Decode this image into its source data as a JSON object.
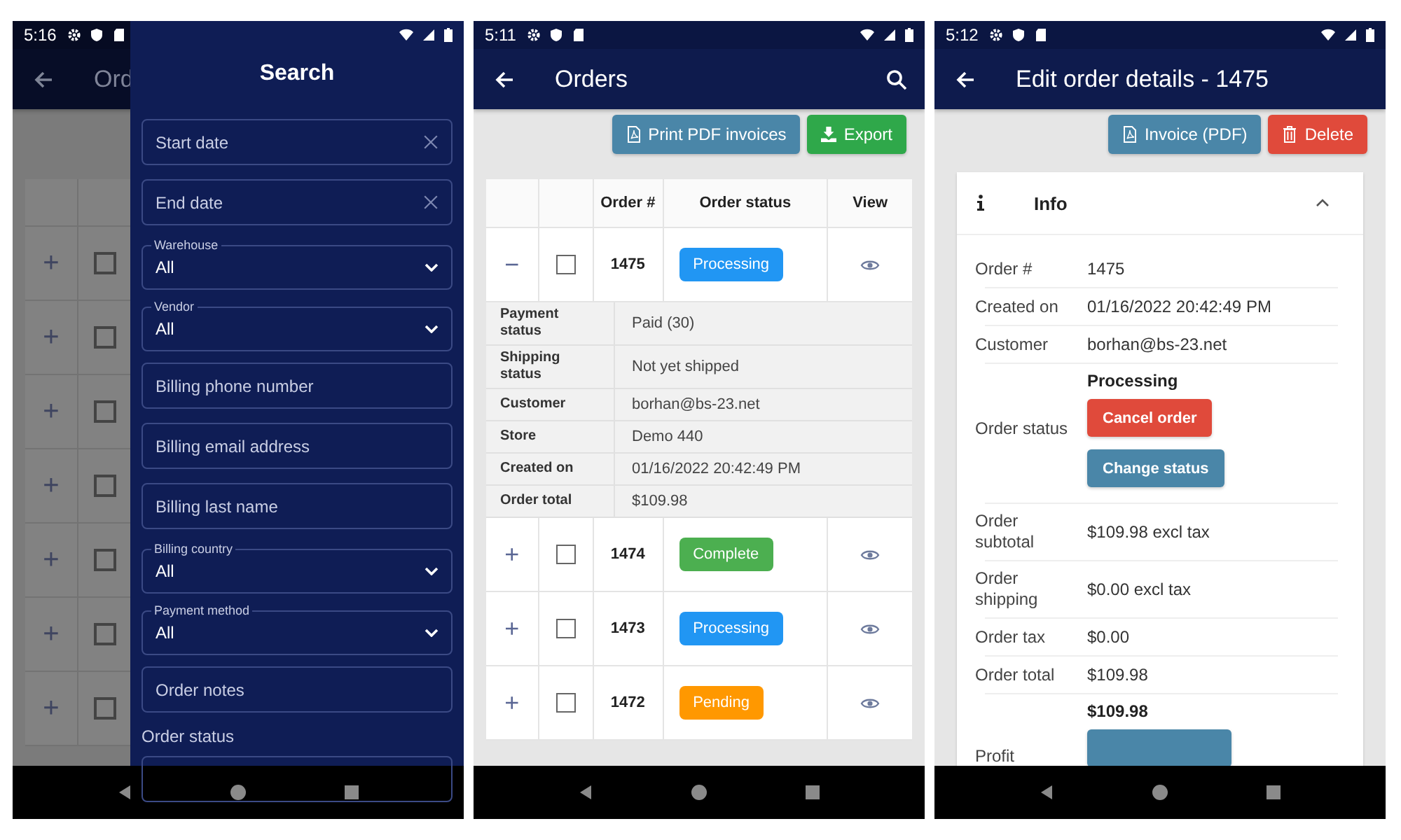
{
  "search_screen": {
    "status_bar": {
      "time": "5:16"
    },
    "background": {
      "title": "Ord",
      "rows": [
        {
          "expand": "+",
          "checked": false
        },
        {
          "expand": "+",
          "checked": false
        },
        {
          "expand": "+",
          "checked": false
        },
        {
          "expand": "+",
          "checked": false
        },
        {
          "expand": "+",
          "checked": false
        },
        {
          "expand": "+",
          "checked": false
        },
        {
          "expand": "+",
          "checked": false
        }
      ]
    },
    "drawer": {
      "title": "Search",
      "fields": [
        {
          "kind": "text",
          "placeholder": "Start date",
          "clearable": true
        },
        {
          "kind": "text",
          "placeholder": "End date",
          "clearable": true
        },
        {
          "kind": "select",
          "label": "Warehouse",
          "value": "All"
        },
        {
          "kind": "select",
          "label": "Vendor",
          "value": "All"
        },
        {
          "kind": "text",
          "placeholder": "Billing phone number",
          "clearable": false
        },
        {
          "kind": "text",
          "placeholder": "Billing email address",
          "clearable": false
        },
        {
          "kind": "text",
          "placeholder": "Billing last name",
          "clearable": false
        },
        {
          "kind": "select",
          "label": "Billing country",
          "value": "All"
        },
        {
          "kind": "select",
          "label": "Payment method",
          "value": "All"
        },
        {
          "kind": "text",
          "placeholder": "Order notes",
          "clearable": false
        }
      ],
      "section_label": "Order status"
    }
  },
  "orders_screen": {
    "status_bar": {
      "time": "5:11"
    },
    "title": "Orders",
    "actions": [
      {
        "kind": "pdf",
        "label": "Print PDF invoices"
      },
      {
        "kind": "export",
        "label": "Export"
      }
    ],
    "columns": {
      "number": "Order #",
      "status": "Order status",
      "view": "View"
    },
    "rows": [
      {
        "expand": "−",
        "checked": false,
        "number": "1475",
        "status": "Processing",
        "color": "#2196f3",
        "details": [
          {
            "label": "Payment status",
            "value": "Paid (30)"
          },
          {
            "label": "Shipping status",
            "value": "Not yet shipped"
          },
          {
            "label": "Customer",
            "value": "borhan@bs-23.net"
          },
          {
            "label": "Store",
            "value": "Demo 440"
          },
          {
            "label": "Created on",
            "value": "01/16/2022 20:42:49 PM"
          },
          {
            "label": "Order total",
            "value": "$109.98"
          }
        ]
      },
      {
        "expand": "+",
        "checked": false,
        "number": "1474",
        "status": "Complete",
        "color": "#4caf50"
      },
      {
        "expand": "+",
        "checked": false,
        "number": "1473",
        "status": "Processing",
        "color": "#2196f3"
      },
      {
        "expand": "+",
        "checked": false,
        "number": "1472",
        "status": "Pending",
        "color": "#ff9800"
      }
    ]
  },
  "order_details_screen": {
    "status_bar": {
      "time": "5:12"
    },
    "title": "Edit order details - 1475",
    "actions": [
      {
        "kind": "pdf",
        "label": "Invoice (PDF)"
      },
      {
        "kind": "delete",
        "label": "Delete"
      }
    ],
    "card": {
      "title": "Info",
      "expanded": true,
      "rows": [
        {
          "kind": "text",
          "label": "Order #",
          "value": "1475"
        },
        {
          "kind": "text",
          "label": "Created on",
          "value": "01/16/2022 20:42:49 PM"
        },
        {
          "kind": "text",
          "label": "Customer",
          "value": "borhan@bs-23.net"
        },
        {
          "kind": "status",
          "label": "Order status",
          "value": "Processing",
          "buttons": [
            {
              "kind": "danger",
              "label": "Cancel order"
            },
            {
              "kind": "primary",
              "label": "Change status"
            }
          ]
        },
        {
          "kind": "text",
          "label": "Order subtotal",
          "value": "$109.98 excl tax"
        },
        {
          "kind": "text",
          "label": "Order shipping",
          "value": "$0.00 excl tax"
        },
        {
          "kind": "text",
          "label": "Order tax",
          "value": "$0.00"
        },
        {
          "kind": "text",
          "label": "Order total",
          "value": "$109.98"
        },
        {
          "kind": "profit",
          "label": "Profit",
          "value": "$109.98"
        }
      ]
    }
  }
}
